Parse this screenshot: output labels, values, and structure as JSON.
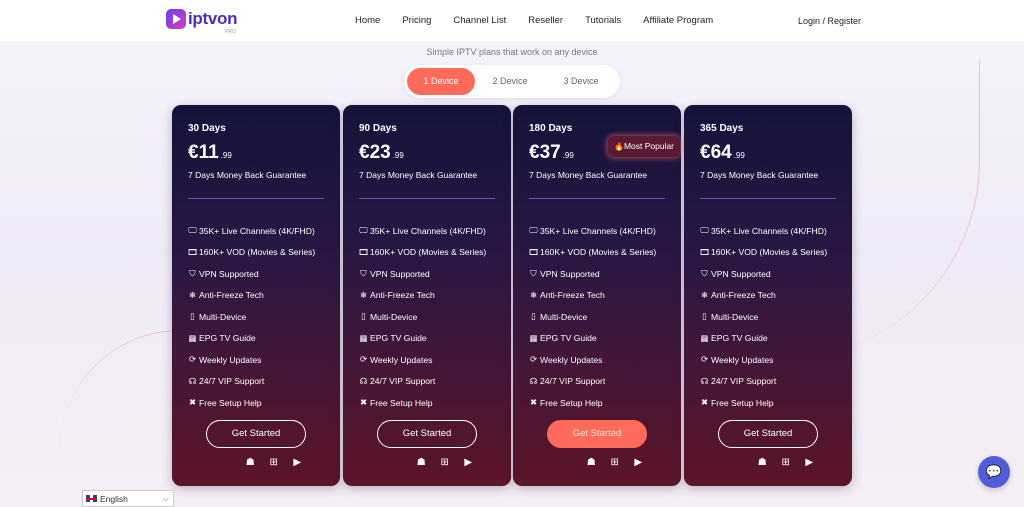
{
  "header": {
    "logo_text": "iptvon",
    "logo_sub": "PRO",
    "nav": [
      "Home",
      "Pricing",
      "Channel List",
      "Reseller",
      "Tutorials",
      "Affiliate Program"
    ],
    "login": "Login / Register"
  },
  "subtitle": "Simple IPTV plans that work on any device",
  "device_tabs": [
    {
      "label": "1 Device",
      "active": true
    },
    {
      "label": "2 Device",
      "active": false
    },
    {
      "label": "3 Device",
      "active": false
    }
  ],
  "badge": {
    "icon": "fire-icon",
    "label": "Most Popular"
  },
  "plans": [
    {
      "days": "30 Days",
      "price": "€11",
      "cents": ".99",
      "guarantee": "7 Days Money Back Guarantee",
      "cta": "Get Started"
    },
    {
      "days": "90 Days",
      "price": "€23",
      "cents": ".99",
      "guarantee": "7 Days Money Back Guarantee",
      "cta": "Get Started"
    },
    {
      "days": "180 Days",
      "price": "€37",
      "cents": ".99",
      "guarantee": "7 Days Money Back Guarantee",
      "cta": "Get Started"
    },
    {
      "days": "365 Days",
      "price": "€64",
      "cents": ".99",
      "guarantee": "7 Days Money Back Guarantee",
      "cta": "Get Started"
    }
  ],
  "features": [
    {
      "icon": "tv-icon",
      "label": "35K+ Live Channels (4K/FHD)"
    },
    {
      "icon": "film-icon",
      "label": "160K+ VOD (Movies & Series)"
    },
    {
      "icon": "shield-icon",
      "label": "VPN Supported"
    },
    {
      "icon": "snowflake-icon",
      "label": "Anti-Freeze Tech"
    },
    {
      "icon": "mobile-icon",
      "label": "Multi-Device"
    },
    {
      "icon": "calendar-icon",
      "label": "EPG TV Guide"
    },
    {
      "icon": "refresh-icon",
      "label": "Weekly Updates"
    },
    {
      "icon": "headset-icon",
      "label": "24/7 VIP Support"
    },
    {
      "icon": "tools-icon",
      "label": "Free Setup Help"
    }
  ],
  "platforms": [
    "apple-icon",
    "android-icon",
    "windows-icon",
    "youtube-icon"
  ],
  "language": "English",
  "colors": {
    "accent": "#ff6a5a",
    "brand": "#4b2db8",
    "chat": "#4f5ed8"
  }
}
